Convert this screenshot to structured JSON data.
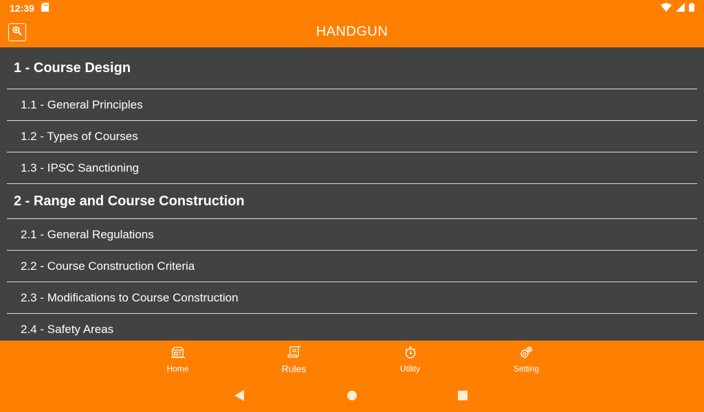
{
  "status_bar": {
    "time": "12:39"
  },
  "app_bar": {
    "title": "HANDGUN",
    "search_icon": "search-icon"
  },
  "sections": [
    {
      "title": "1 - Course Design",
      "items": [
        "1.1 - General Principles",
        "1.2 - Types of Courses",
        "1.3 - IPSC Sanctioning"
      ]
    },
    {
      "title": "2 - Range and Course Construction",
      "items": [
        "2.1 - General Regulations",
        "2.2 - Course Construction Criteria",
        "2.3 - Modifications to Course Construction",
        "2.4 - Safety Areas"
      ]
    }
  ],
  "bottom_nav": {
    "items": [
      {
        "label": "Home",
        "icon": "home-icon"
      },
      {
        "label": "Rules",
        "icon": "rules-icon"
      },
      {
        "label": "Utility",
        "icon": "stopwatch-icon"
      },
      {
        "label": "Setting",
        "icon": "settings-icon"
      }
    ],
    "active": "Rules"
  },
  "colors": {
    "accent": "#ff8000",
    "background": "#424242",
    "divider": "#e0e0e0",
    "text": "#ffffff"
  }
}
